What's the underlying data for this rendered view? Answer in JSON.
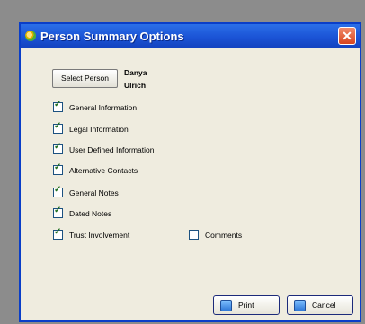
{
  "dialog": {
    "title": "Person Summary Options",
    "close_glyph": "✕"
  },
  "select_person": {
    "label": "Select Person",
    "name_first": "Danya",
    "name_last": "Ulrich"
  },
  "options": [
    {
      "label": "General Information",
      "checked": true
    },
    {
      "label": "Legal Information",
      "checked": true
    },
    {
      "label": "User Defined Information",
      "checked": true
    },
    {
      "label": "Alternative Contacts",
      "checked": true
    },
    {
      "label": "General Notes",
      "checked": true
    },
    {
      "label": "Dated Notes",
      "checked": true
    },
    {
      "label": "Trust Involvement",
      "checked": true
    }
  ],
  "comments": {
    "label": "Comments",
    "checked": false
  },
  "buttons": {
    "print": "Print",
    "cancel": "Cancel"
  },
  "icons": {
    "title": "app-icon",
    "close": "close-icon",
    "print": "print-icon",
    "cancel": "cancel-icon"
  },
  "colors": {
    "titlebar": "#1b54d6",
    "dialog_bg": "#efecdf",
    "close": "#d8451f"
  }
}
